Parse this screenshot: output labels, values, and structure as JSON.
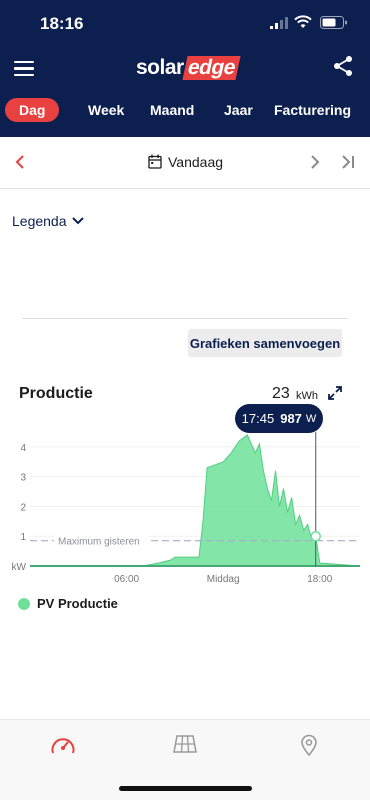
{
  "status_bar": {
    "time": "18:16"
  },
  "header": {
    "logo_left": "solar",
    "logo_right": "edge"
  },
  "tabs": [
    {
      "label": "Dag",
      "active": true
    },
    {
      "label": "Week",
      "active": false
    },
    {
      "label": "Maand",
      "active": false
    },
    {
      "label": "Jaar",
      "active": false
    },
    {
      "label": "Facturering",
      "active": false
    }
  ],
  "date_nav": {
    "label": "Vandaag"
  },
  "legenda": {
    "label": "Legenda"
  },
  "merge_button": {
    "label": "Grafieken samenvoegen"
  },
  "production": {
    "title": "Productie",
    "total": "23",
    "unit": "kWh"
  },
  "tooltip": {
    "time": "17:45",
    "value": "987",
    "unit": "W"
  },
  "colors": {
    "brand_navy": "#0c1f4f",
    "accent_red": "#e8413f",
    "pv_green": "#6fe09a"
  },
  "chart_data": {
    "type": "area",
    "ylabel": "kW",
    "ylim": [
      0,
      4.5
    ],
    "yticks": [
      "1",
      "2",
      "3",
      "4"
    ],
    "xticks": [
      "06:00",
      "Middag",
      "18:00"
    ],
    "xlim": [
      0,
      20.5
    ],
    "reference_line": {
      "label": "Maximum gisteren",
      "value": 0.85
    },
    "tooltip_x": 17.75,
    "series": [
      {
        "name": "PV Productie",
        "x": [
          0,
          7.0,
          8.0,
          8.75,
          9.0,
          10.5,
          10.75,
          11.0,
          11.5,
          12.0,
          12.5,
          13.0,
          13.5,
          13.75,
          14.0,
          14.25,
          14.5,
          14.75,
          15.0,
          15.25,
          15.5,
          15.75,
          16.0,
          16.25,
          16.5,
          16.75,
          17.0,
          17.25,
          17.5,
          17.75,
          18.0,
          20.5
        ],
        "y": [
          0,
          0.0,
          0.1,
          0.2,
          0.3,
          0.3,
          1.5,
          3.3,
          3.4,
          3.5,
          3.8,
          4.2,
          4.4,
          4.1,
          3.8,
          4.1,
          3.2,
          2.6,
          2.2,
          3.2,
          2.0,
          2.6,
          1.8,
          2.3,
          1.4,
          1.7,
          1.2,
          1.4,
          0.9,
          1.0,
          0.1,
          0.0
        ]
      }
    ]
  },
  "bottom_nav": [
    {
      "icon": "dashboard-gauge-icon",
      "active": true
    },
    {
      "icon": "solar-panel-icon",
      "active": false
    },
    {
      "icon": "location-pin-icon",
      "active": false
    }
  ]
}
